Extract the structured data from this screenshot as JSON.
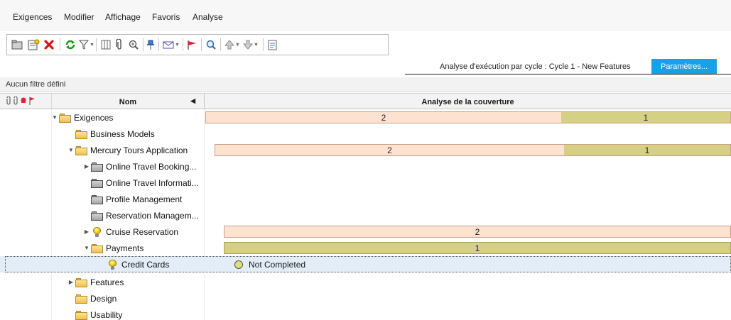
{
  "menu": {
    "items": [
      "Exigences",
      "Modifier",
      "Affichage",
      "Favoris",
      "Analyse"
    ]
  },
  "toolbar": {
    "buttons": [
      "new-folder-icon",
      "new-requirement-icon",
      "delete-icon",
      "refresh-icon",
      "filter-icon",
      "columns-icon",
      "attachment-icon",
      "zoom-icon",
      "pin-icon",
      "mail-icon",
      "flag-icon",
      "find-icon",
      "move-up-icon",
      "move-down-icon",
      "report-icon"
    ]
  },
  "analysis": {
    "title": "Analyse d'exécution par cycle : Cycle 1 - New Features",
    "params_label": "Paramètres..."
  },
  "filter": {
    "label": "Aucun filtre défini"
  },
  "table": {
    "headers": {
      "name": "Nom",
      "coverage": "Analyse de la couverture"
    },
    "rows": [
      {
        "label": "Exigences",
        "icon": "folder-icon",
        "expander": "expanded",
        "coverage": {
          "peach": "2",
          "olive": "1"
        }
      },
      {
        "label": "Business Models",
        "icon": "folder-icon",
        "expander": "none"
      },
      {
        "label": "Mercury Tours Application",
        "icon": "folder-icon",
        "expander": "expanded",
        "coverage": {
          "peach": "2",
          "olive": "1"
        }
      },
      {
        "label": "Online Travel Booking...",
        "icon": "grey-folder-icon",
        "expander": "collapsed"
      },
      {
        "label": "Online Travel Informati...",
        "icon": "grey-folder-icon",
        "expander": "none"
      },
      {
        "label": "Profile Management",
        "icon": "grey-folder-icon",
        "expander": "none"
      },
      {
        "label": "Reservation Managem...",
        "icon": "grey-folder-icon",
        "expander": "none"
      },
      {
        "label": "Cruise Reservation",
        "icon": "bulb-icon",
        "expander": "collapsed",
        "coverage": {
          "peach": "2"
        }
      },
      {
        "label": "Payments",
        "icon": "folder-icon",
        "expander": "expanded",
        "coverage": {
          "olive": "1"
        }
      },
      {
        "label": "Credit Cards",
        "icon": "bulb-icon",
        "expander": "none",
        "status": "Not Completed"
      },
      {
        "label": "Features",
        "icon": "folder-icon",
        "expander": "collapsed"
      },
      {
        "label": "Design",
        "icon": "folder-icon",
        "expander": "none"
      },
      {
        "label": "Usability",
        "icon": "folder-icon",
        "expander": "none"
      }
    ]
  },
  "colors": {
    "not_covered": "#fde2d0",
    "not_completed": "#d5d084",
    "accent": "#1aa0e8"
  }
}
